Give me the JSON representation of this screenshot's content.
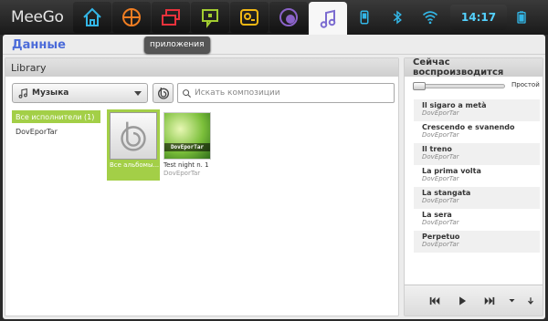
{
  "topbar": {
    "logo": "MeeGo",
    "apps": [
      {
        "icon": "home-icon",
        "color": "#33b6e6"
      },
      {
        "icon": "grid-icon",
        "color": "#ef7d22"
      },
      {
        "icon": "windows-icon",
        "color": "#e8323c"
      },
      {
        "icon": "chat-icon",
        "color": "#a2cc30"
      },
      {
        "icon": "people-icon",
        "color": "#f2b814"
      },
      {
        "icon": "media-icon",
        "color": "#8a62c8"
      },
      {
        "icon": "music-note-icon",
        "color": "#7b6bd0"
      }
    ],
    "clock": "14:17",
    "status_icons": [
      "phone-icon",
      "bluetooth-icon",
      "wifi-icon",
      "battery-icon"
    ]
  },
  "tooltip": "приложения",
  "page": {
    "title": "Данные"
  },
  "library": {
    "header": "Library",
    "dropdown_value": "Музыка",
    "search_placeholder": "Искать композиции",
    "artists": [
      "Все исполнители (1)",
      "DovEporTar"
    ],
    "albums": [
      {
        "title": "Все альбомы...",
        "artist": ""
      },
      {
        "title": "Test night n. 1",
        "artist": "DovEporTar",
        "art_label": "DovEporTar"
      }
    ]
  },
  "now_playing": {
    "header": "Сейчас воспроизводится",
    "slider_label": "Простой",
    "slider_value": 0.0,
    "tracks": [
      {
        "title": "Il sigaro a metà",
        "artist": "DovEporTar"
      },
      {
        "title": "Crescendo e svanendo",
        "artist": "DovEporTar"
      },
      {
        "title": "Il treno",
        "artist": "DovEporTar"
      },
      {
        "title": "La prima volta",
        "artist": "DovEporTar"
      },
      {
        "title": "La stangata",
        "artist": "DovEporTar"
      },
      {
        "title": "La sera",
        "artist": "DovEporTar"
      },
      {
        "title": "Perpetuo",
        "artist": "DovEporTar"
      }
    ]
  },
  "colors": {
    "accent_blue": "#4b6bd9",
    "selection_green": "#a3cf47",
    "clock_blue": "#54d2ff"
  }
}
